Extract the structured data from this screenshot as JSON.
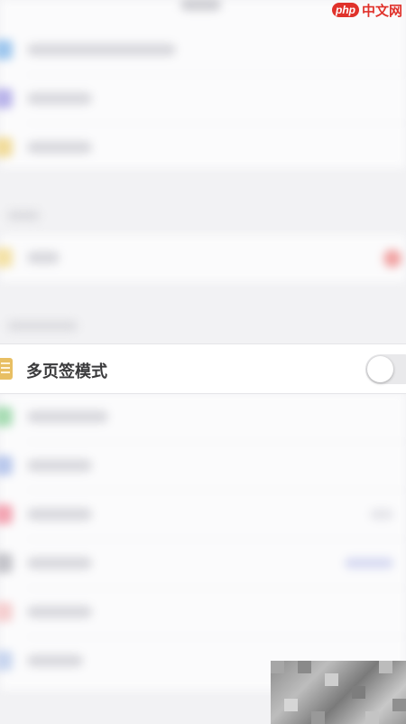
{
  "watermark": {
    "badge": "php",
    "text": "中文网"
  },
  "focused_setting": {
    "label": "多页签模式",
    "toggle_on": false
  },
  "colors": {
    "icon_yellow": "#e8bf63",
    "brand_red": "#e0322b",
    "toggle_off": "#e9e9eb"
  }
}
